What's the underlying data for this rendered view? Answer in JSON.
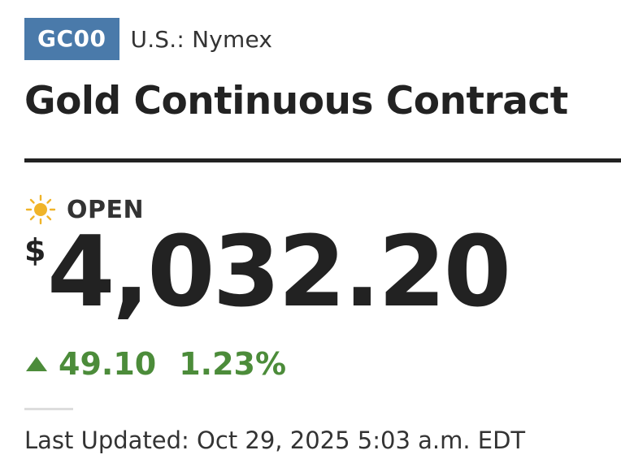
{
  "ticker": {
    "symbol": "GC00",
    "exchange": "U.S.: Nymex"
  },
  "title": "Gold Continuous Contract",
  "status": {
    "icon": "sun-icon",
    "label": "OPEN"
  },
  "price": {
    "currency_symbol": "$",
    "value": "4,032.20"
  },
  "change": {
    "direction": "up",
    "value": "49.10",
    "percent": "1.23%",
    "color": "#4c8c3a"
  },
  "last_updated": "Last Updated: Oct 29, 2025 5:03 a.m. EDT",
  "colors": {
    "badge_background": "#4a7aaa",
    "text": "#222222",
    "sun": "#f0b429"
  }
}
